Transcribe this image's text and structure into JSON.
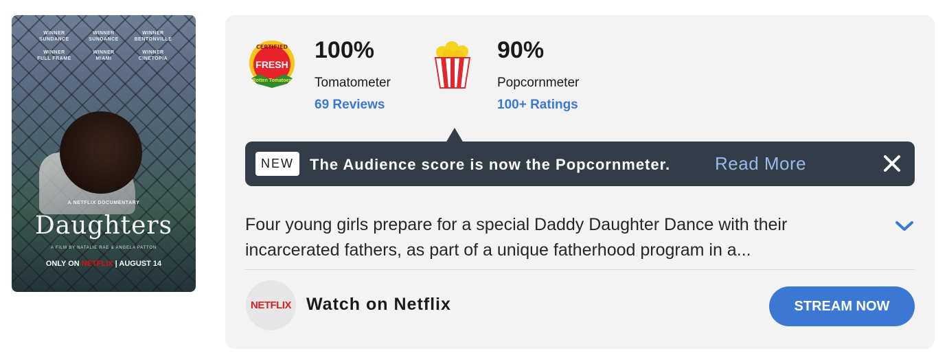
{
  "poster": {
    "laurels": [
      {
        "title": "WINNER",
        "festival": "SUNDANCE"
      },
      {
        "title": "WINNER",
        "festival": "SUNDANCE"
      },
      {
        "title": "WINNER",
        "festival": "BENTONVILLE"
      },
      {
        "title": "WINNER",
        "festival": "FULL FRAME"
      },
      {
        "title": "WINNER",
        "festival": "MIAMI"
      },
      {
        "title": "WINNER",
        "festival": "CINETOPIA"
      }
    ],
    "label": "A NETFLIX DOCUMENTARY",
    "title": "Daughters",
    "credit": "A FILM BY NATALIE RAE & ANGELA PATTON",
    "release_prefix": "ONLY ON",
    "release_brand": "NETFLIX",
    "release_date": "AUGUST 14"
  },
  "scores": {
    "tomatometer": {
      "value": "100%",
      "label": "Tomatometer",
      "link": "69 Reviews",
      "badge_top": "CERTIFIED",
      "badge_mid": "FRESH",
      "badge_bottom": "Rotten Tomatoes"
    },
    "popcornmeter": {
      "value": "90%",
      "label": "Popcornmeter",
      "link": "100+ Ratings"
    }
  },
  "banner": {
    "tag": "NEW",
    "text": "The Audience score is now the Popcornmeter.",
    "link": "Read More"
  },
  "synopsis": {
    "line1": "Four young girls prepare for a special Daddy Daughter Dance with their",
    "line2": "incarcerated fathers, as part of a unique fatherhood program in a..."
  },
  "watch": {
    "provider": "NETFLIX",
    "text": "Watch on Netflix",
    "button": "STREAM NOW"
  },
  "colors": {
    "accent": "#3a78d4",
    "banner_bg": "#333d47",
    "netflix_red": "#d81f26",
    "card_bg": "#f3f3f3"
  }
}
